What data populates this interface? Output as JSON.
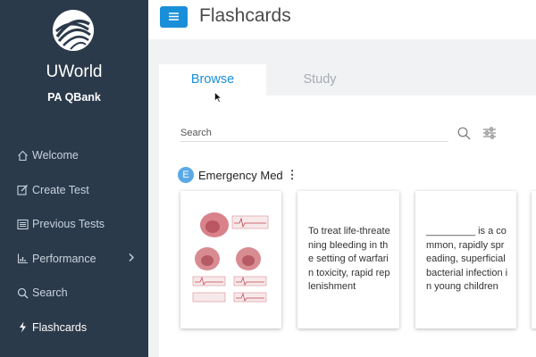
{
  "sidebar": {
    "brand": "UWorld",
    "product": "PA QBank",
    "items": [
      {
        "label": "Welcome",
        "icon": "home-icon"
      },
      {
        "label": "Create Test",
        "icon": "edit-icon"
      },
      {
        "label": "Previous Tests",
        "icon": "list-icon"
      },
      {
        "label": "Performance",
        "icon": "chart-icon"
      },
      {
        "label": "Search",
        "icon": "search-icon"
      },
      {
        "label": "Flashcards",
        "icon": "bolt-icon"
      }
    ],
    "active": "Flashcards"
  },
  "header": {
    "title": "Flashcards"
  },
  "tabs": [
    {
      "label": "Browse",
      "active": true
    },
    {
      "label": "Study",
      "active": false
    }
  ],
  "search": {
    "placeholder": "Search"
  },
  "deck": {
    "badge": "E",
    "title": "Emergency Med",
    "more": "⋮"
  },
  "cards": [
    {
      "type": "image",
      "image": "heart-ecg-diagram"
    },
    {
      "type": "text",
      "text": "To treat life-threatening bleeding in the setting of warfarin toxicity, rapid replenishment"
    },
    {
      "type": "text",
      "text": "_________ is a common, rapidly spreading, superficial bacterial infection in young children"
    }
  ],
  "colors": {
    "sidebar_bg": "#2b3a4b",
    "accent": "#1a8fd9",
    "main_bg": "#f1f2f4"
  }
}
